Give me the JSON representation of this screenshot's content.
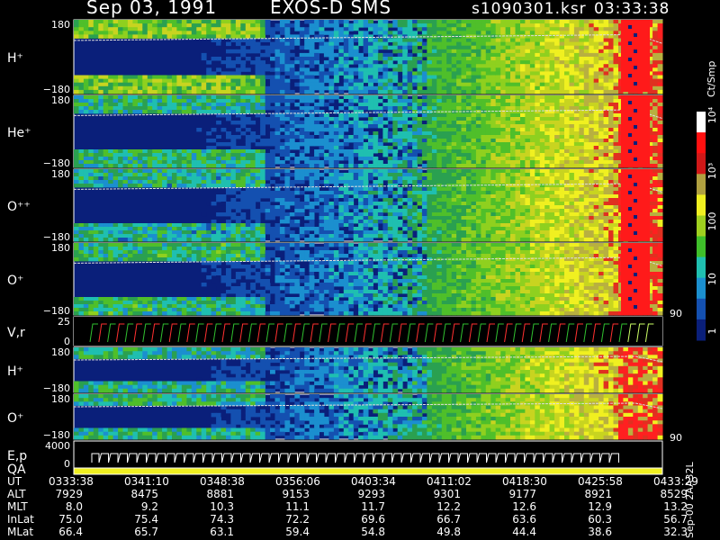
{
  "header": {
    "date": "Sep 03, 1991",
    "mission": "EXOS-D SMS",
    "file": "s1090301.ksr",
    "time": "03:33:38"
  },
  "colorbar": {
    "unit": "Ct/Smp",
    "tick_labels": [
      "1",
      "10",
      "100",
      "10³",
      "10⁴"
    ]
  },
  "side": {
    "label_90_top": "90",
    "label_90_bottom": "90",
    "footnote": "Sep-00 2AA32L"
  },
  "chart_data": {
    "type": "heatmap",
    "title": "Sep 03, 1991   EXOS-D SMS",
    "x_label": "UT",
    "x_ticks": [
      "0333:38",
      "0341:10",
      "0348:38",
      "0356:06",
      "0403:34",
      "0411:02",
      "0418:30",
      "0425:58",
      "0433:29"
    ],
    "panels": [
      {
        "name": "H⁺",
        "y_max": "180",
        "y_min": "−180"
      },
      {
        "name": "He⁺",
        "y_max": "180",
        "y_min": "−180"
      },
      {
        "name": "O⁺⁺",
        "y_max": "180",
        "y_min": "−180"
      },
      {
        "name": "O⁺",
        "y_max": "180",
        "y_min": "−180"
      },
      {
        "name": "V,r",
        "y_max": "25",
        "y_min": "0"
      },
      {
        "name": "H⁺",
        "y_max": "180",
        "y_min": "−180"
      },
      {
        "name": "O⁺",
        "y_max": "180",
        "y_min": "−180"
      },
      {
        "name": "E,p",
        "y_max": "4000",
        "y_min": "0"
      },
      {
        "name": "QA",
        "y_max": "",
        "y_min": ""
      }
    ],
    "ephemeris": [
      {
        "label": "ALT",
        "values": [
          "7929",
          "8475",
          "8881",
          "9153",
          "9293",
          "9301",
          "9177",
          "8921",
          "8529"
        ]
      },
      {
        "label": "MLT",
        "values": [
          "8.0",
          "9.2",
          "10.3",
          "11.1",
          "11.7",
          "12.2",
          "12.6",
          "12.9",
          "13.2"
        ]
      },
      {
        "label": "InLat",
        "values": [
          "75.0",
          "75.4",
          "74.3",
          "72.2",
          "69.6",
          "66.7",
          "63.6",
          "60.3",
          "56.7"
        ]
      },
      {
        "label": "MLat",
        "values": [
          "66.4",
          "65.7",
          "63.1",
          "59.4",
          "54.8",
          "49.8",
          "44.4",
          "38.6",
          "32.3"
        ]
      }
    ]
  }
}
